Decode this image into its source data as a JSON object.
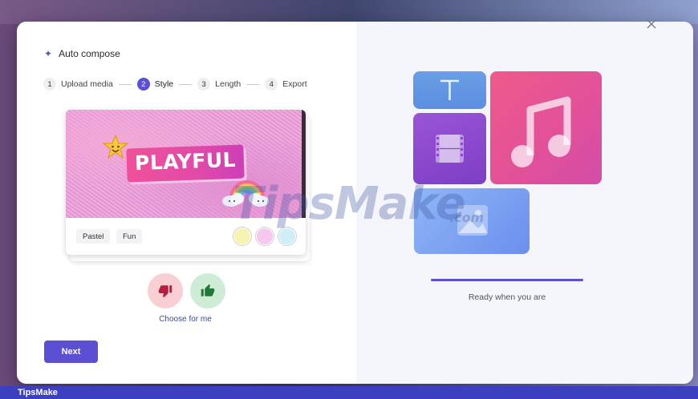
{
  "dialog": {
    "title": "Auto compose",
    "title_icon": "sparkle-icon",
    "close_icon": "close-icon"
  },
  "steps": [
    {
      "number": "1",
      "label": "Upload media",
      "active": false
    },
    {
      "number": "2",
      "label": "Style",
      "active": true
    },
    {
      "number": "3",
      "label": "Length",
      "active": false
    },
    {
      "number": "4",
      "label": "Export",
      "active": false
    }
  ],
  "style_card": {
    "preview_text": "PLAYFUL",
    "tags": [
      "Pastel",
      "Fun"
    ],
    "swatches": [
      "#f7f4b0",
      "#f6c8ef",
      "#cdeff8"
    ]
  },
  "feedback": {
    "dislike_icon": "thumbs-down-icon",
    "like_icon": "thumbs-up-icon",
    "choose_label": "Choose for me"
  },
  "actions": {
    "next_label": "Next"
  },
  "preview_panel": {
    "tiles": [
      "text-icon",
      "music-note-icon",
      "film-icon",
      "image-icon"
    ],
    "progress_fraction": 1.0,
    "status_text": "Ready when you are"
  },
  "watermark": {
    "brand": "TipsMake",
    "brand_suffix": ".com"
  },
  "footer": {
    "label": "TipsMake"
  },
  "colors": {
    "accent": "#5b4fd4",
    "link": "#3a4a9a",
    "footer_bar": "#3b3fc0"
  }
}
